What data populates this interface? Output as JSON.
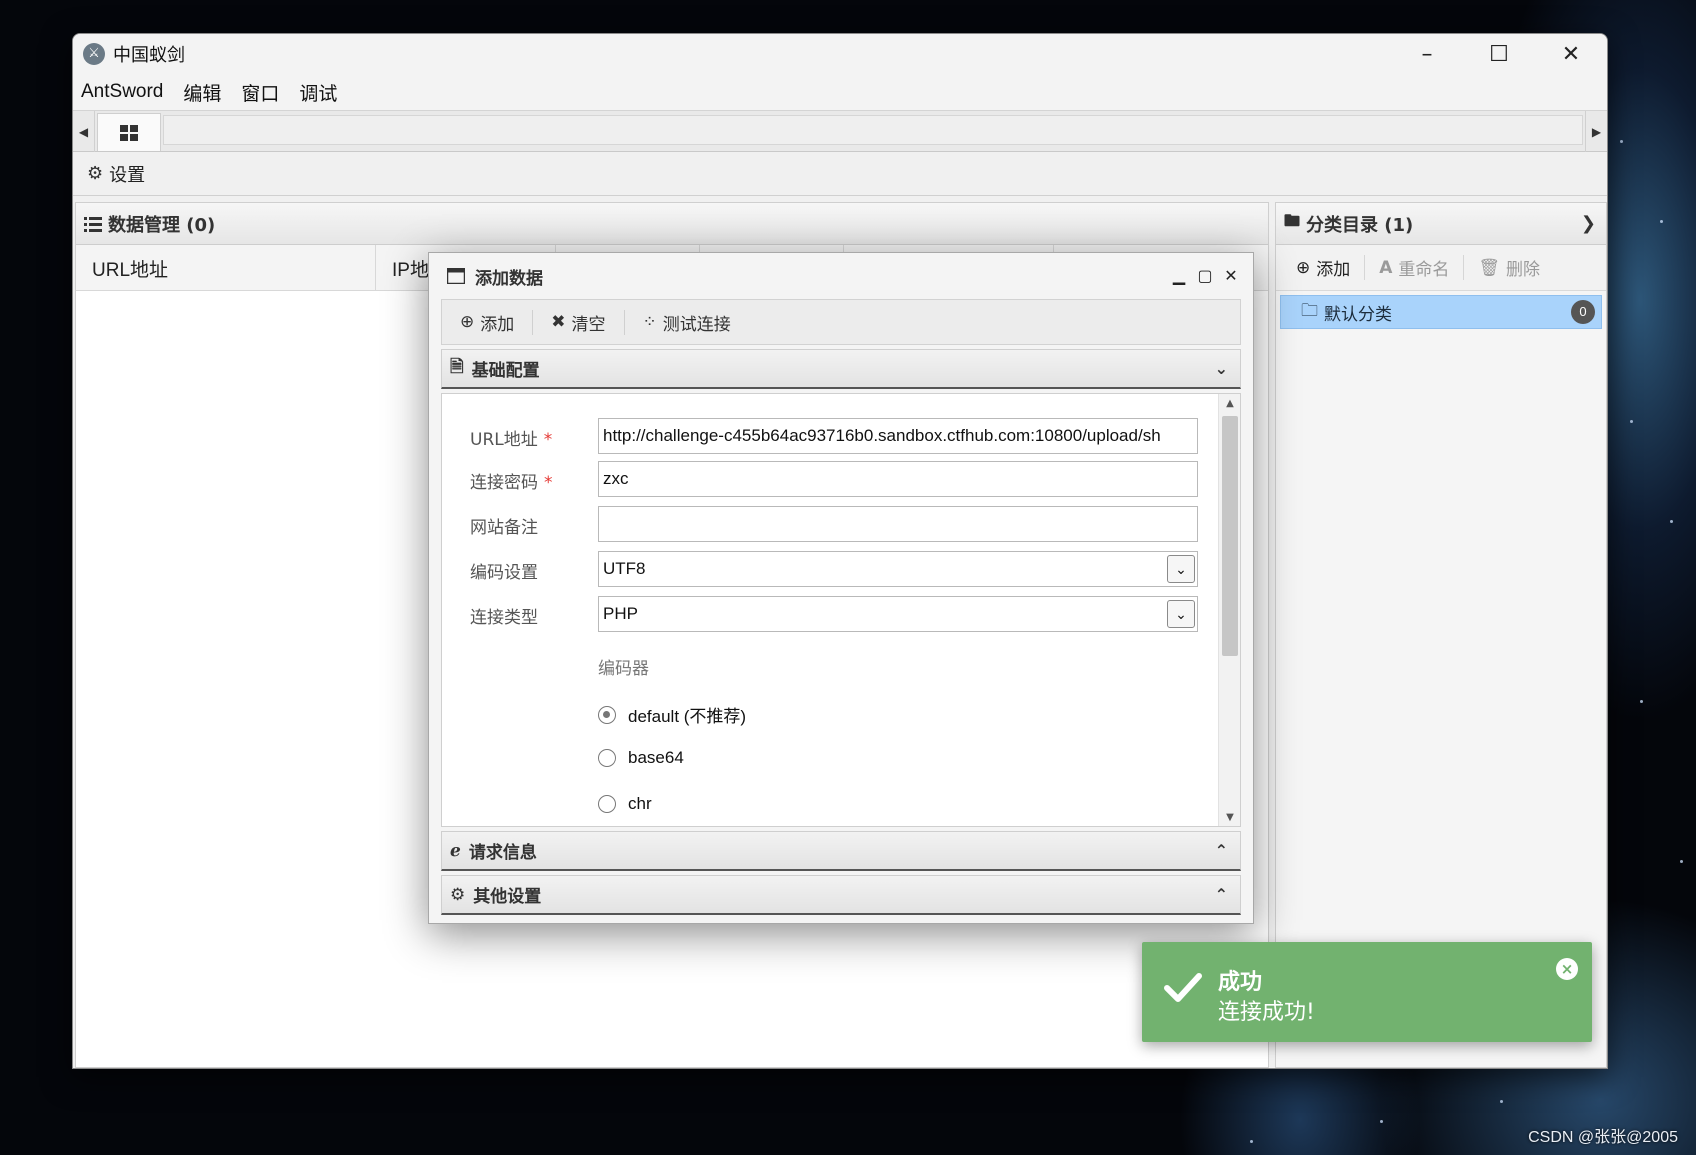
{
  "window": {
    "app_icon_glyph": "⚔",
    "title": "中国蚁剑",
    "controls": {
      "minimize": "–",
      "maximize": "☐",
      "close": "✕"
    }
  },
  "menu": [
    "AntSword",
    "编辑",
    "窗口",
    "调试"
  ],
  "toolbar": {
    "settings_label": "设置"
  },
  "data_panel": {
    "title": "数据管理 (0)",
    "columns": [
      "URL地址",
      "IP地",
      "",
      "",
      "",
      ""
    ]
  },
  "category_panel": {
    "title": "分类目录 (1)",
    "tools": {
      "add": "添加",
      "rename": "重命名",
      "delete": "删除"
    },
    "items": [
      {
        "label": "默认分类",
        "count": "0"
      }
    ]
  },
  "dialog": {
    "title": "添加数据",
    "toolbar": {
      "add": "添加",
      "clear": "清空",
      "test": "测试连接"
    },
    "sections": {
      "basic": "基础配置",
      "request": "请求信息",
      "other": "其他设置"
    },
    "fields": {
      "url_label": "URL地址",
      "url_value": "http://challenge-c455b64ac93716b0.sandbox.ctfhub.com:10800/upload/sh",
      "password_label": "连接密码",
      "password_value": "zxc",
      "note_label": "网站备注",
      "note_value": "",
      "encoding_label": "编码设置",
      "encoding_value": "UTF8",
      "type_label": "连接类型",
      "type_value": "PHP",
      "required_mark": "*"
    },
    "encoder": {
      "title": "编码器",
      "options": [
        {
          "label": "default (不推荐)",
          "checked": true
        },
        {
          "label": "base64",
          "checked": false
        },
        {
          "label": "chr",
          "checked": false
        }
      ]
    }
  },
  "toast": {
    "title": "成功",
    "message": "连接成功!",
    "color": "#72b26f"
  },
  "watermark": "CSDN @张张@2005"
}
